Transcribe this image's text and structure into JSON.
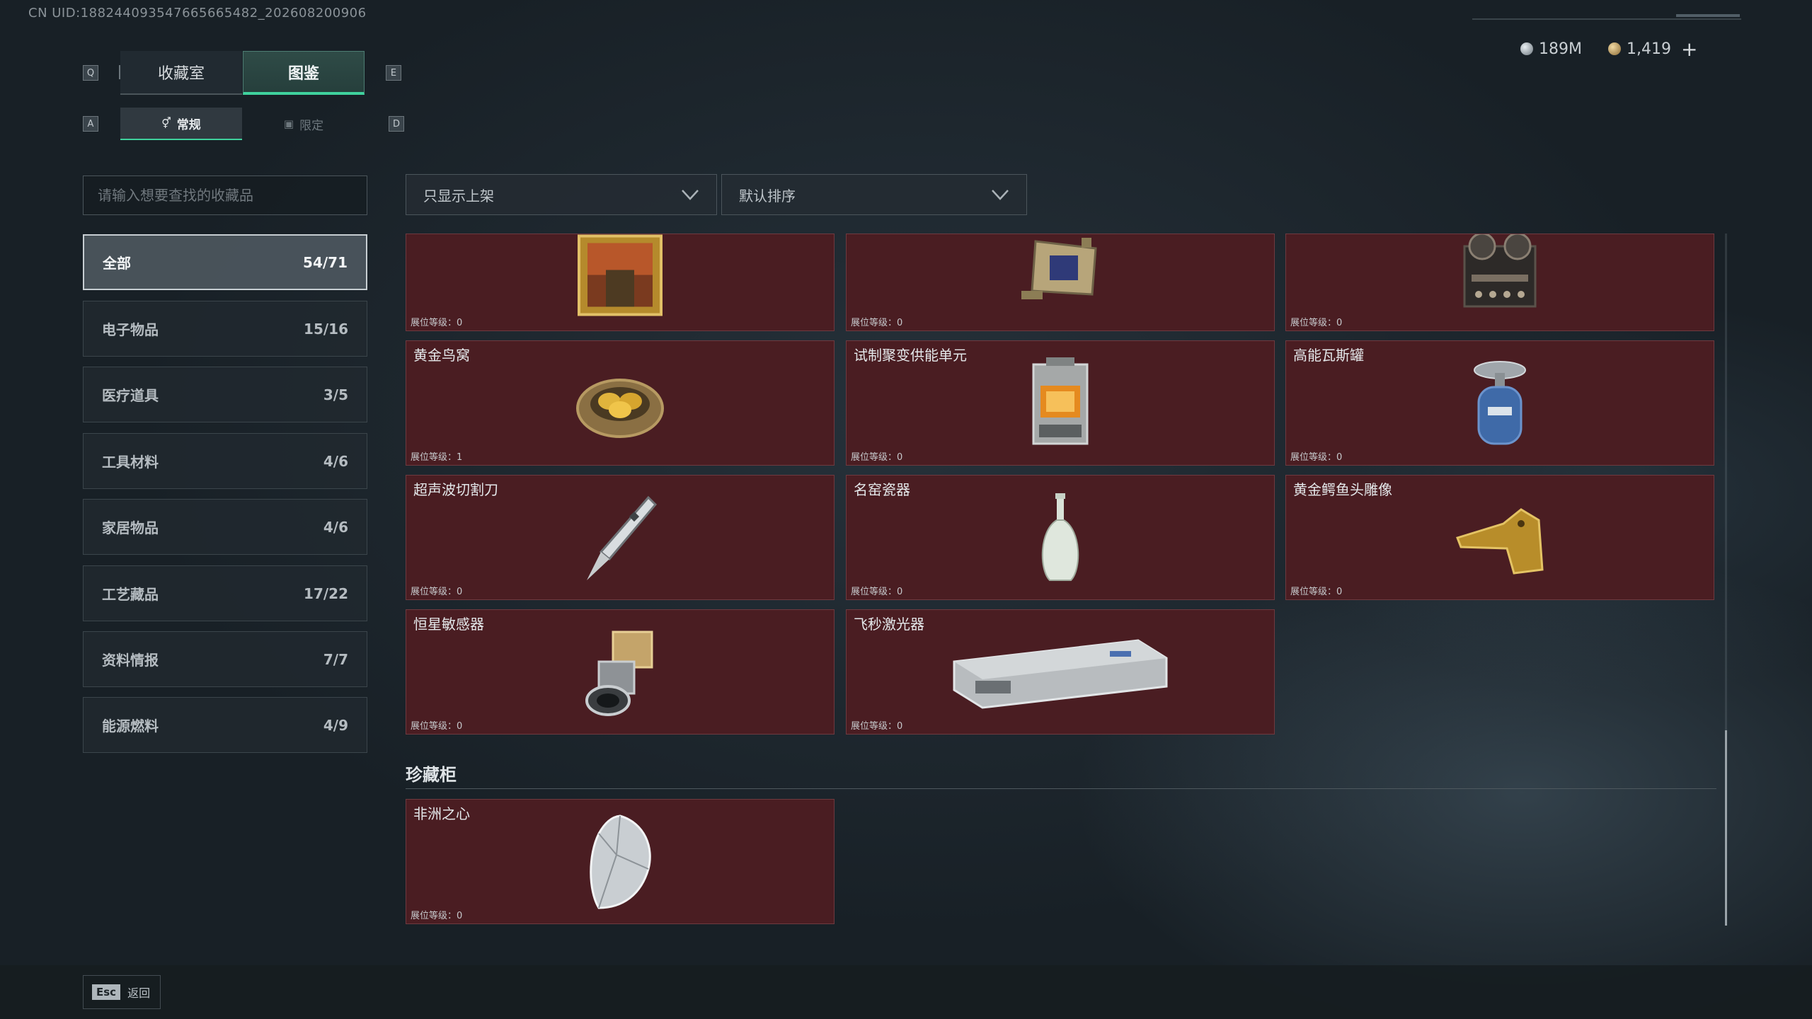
{
  "uid": "CN UID:188244093547665665482_202608200906",
  "currency": {
    "silver": "189M",
    "gold": "1,419",
    "add_symbol": "+"
  },
  "keys": {
    "q": "Q",
    "e": "E",
    "a": "A",
    "d": "D"
  },
  "main_tabs": [
    {
      "label": "收藏室",
      "active": false
    },
    {
      "label": "图鉴",
      "active": true
    }
  ],
  "sub_tabs": [
    {
      "label": "常规",
      "active": true
    },
    {
      "label": "限定",
      "active": false
    }
  ],
  "search": {
    "placeholder": "请输入想要查找的收藏品",
    "value": ""
  },
  "categories": [
    {
      "label": "全部",
      "count": "54/71",
      "selected": true
    },
    {
      "label": "电子物品",
      "count": "15/16"
    },
    {
      "label": "医疗道具",
      "count": "3/5"
    },
    {
      "label": "工具材料",
      "count": "4/6"
    },
    {
      "label": "家居物品",
      "count": "4/6"
    },
    {
      "label": "工艺藏品",
      "count": "17/22"
    },
    {
      "label": "资料情报",
      "count": "7/7"
    },
    {
      "label": "能源燃料",
      "count": "4/9"
    }
  ],
  "filters": {
    "shelf": "只显示上架",
    "sort": "默认排序"
  },
  "level_label": "展位等级：",
  "items": [
    {
      "name": "",
      "level": "0",
      "icon": "painting-icon"
    },
    {
      "name": "",
      "level": "0",
      "icon": "device-icon"
    },
    {
      "name": "",
      "level": "0",
      "icon": "tape-recorder-icon"
    },
    {
      "name": "黄金鸟窝",
      "level": "1",
      "icon": "golden-nest-icon"
    },
    {
      "name": "试制聚变供能单元",
      "level": "0",
      "icon": "fusion-unit-icon"
    },
    {
      "name": "高能瓦斯罐",
      "level": "0",
      "icon": "gas-tank-icon"
    },
    {
      "name": "超声波切割刀",
      "level": "0",
      "icon": "cutter-icon"
    },
    {
      "name": "名窑瓷器",
      "level": "0",
      "icon": "porcelain-vase-icon"
    },
    {
      "name": "黄金鳄鱼头雕像",
      "level": "0",
      "icon": "crocodile-statue-icon"
    },
    {
      "name": "恒星敏感器",
      "level": "0",
      "icon": "star-sensor-icon"
    },
    {
      "name": "飞秒激光器",
      "level": "0",
      "icon": "laser-device-icon"
    }
  ],
  "cabinet": {
    "title": "珍藏柜",
    "items": [
      {
        "name": "非洲之心",
        "level": "0",
        "icon": "diamond-icon"
      }
    ]
  },
  "footer": {
    "esc": "Esc",
    "back": "返回"
  },
  "colors": {
    "accent": "#3fd29d",
    "card_bg": "#4a1d22"
  }
}
